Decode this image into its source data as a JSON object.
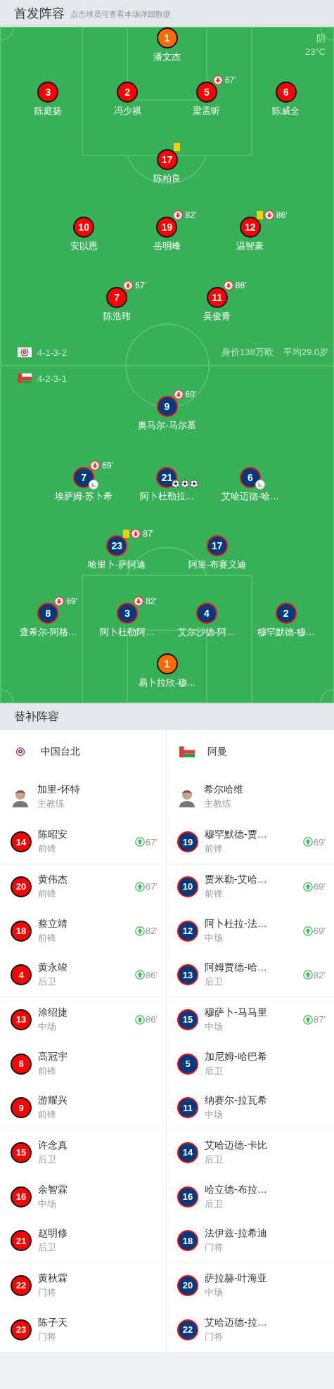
{
  "lineup": {
    "title": "首发阵容",
    "hint": "点击球员可查看本场详细数据",
    "weather": {
      "condition": "阴",
      "temperature": "23°C"
    },
    "value": "身价138万欧",
    "average_age": "平均29.0岁",
    "teams": [
      {
        "formation": "4-1-3-2",
        "color": "#ff0000",
        "lines": [
          {
            "kind": "goalkeeper",
            "players": [
              {
                "number": "1",
                "name": "潘文杰"
              }
            ]
          },
          {
            "kind": "outfield",
            "players": [
              {
                "number": "3",
                "name": "陈庭扬"
              },
              {
                "number": "2",
                "name": "冯少祺"
              },
              {
                "number": "5",
                "name": "梁孟昕",
                "events": [
                  {
                    "kind": "sub_off",
                    "minute": "67'"
                  }
                ]
              },
              {
                "number": "6",
                "name": "陈威全"
              }
            ]
          },
          {
            "kind": "outfield",
            "players": [
              {
                "number": "17",
                "name": "陈柏良",
                "events": [
                  {
                    "kind": "yellow_card"
                  }
                ]
              }
            ]
          },
          {
            "kind": "outfield",
            "players": [
              {
                "number": "10",
                "name": "安以恩"
              },
              {
                "number": "19",
                "name": "岳明峰",
                "events": [
                  {
                    "kind": "sub_off",
                    "minute": "82'"
                  }
                ]
              },
              {
                "number": "12",
                "name": "温智豪",
                "events": [
                  {
                    "kind": "yellow_card"
                  },
                  {
                    "kind": "sub_off",
                    "minute": "86'"
                  }
                ]
              }
            ]
          },
          {
            "kind": "outfield",
            "players": [
              {
                "number": "7",
                "name": "陈浩玮",
                "events": [
                  {
                    "kind": "sub_off",
                    "minute": "67'"
                  }
                ]
              },
              {
                "number": "11",
                "name": "吴俊青",
                "events": [
                  {
                    "kind": "sub_off",
                    "minute": "86'"
                  }
                ]
              }
            ]
          }
        ]
      },
      {
        "formation": "4-2-3-1",
        "color": "#003a7d",
        "lines": [
          {
            "kind": "outfield",
            "players": [
              {
                "number": "9",
                "name": "奥马尔-马尔基",
                "events": [
                  {
                    "kind": "sub_off",
                    "minute": "69'"
                  }
                ]
              }
            ]
          },
          {
            "kind": "outfield",
            "players": [
              {
                "number": "7",
                "name": "埃萨姆-苏卜希",
                "events": [
                  {
                    "kind": "sub_off",
                    "minute": "69'"
                  },
                  {
                    "kind": "assist"
                  }
                ]
              },
              {
                "number": "21",
                "name": "阿卜杜勒拉…",
                "events": [
                  {
                    "kind": "goal"
                  },
                  {
                    "kind": "goal"
                  },
                  {
                    "kind": "goal"
                  }
                ]
              },
              {
                "number": "6",
                "name": "艾哈迈德-哈…",
                "events": [
                  {
                    "kind": "assist"
                  }
                ]
              }
            ]
          },
          {
            "kind": "outfield",
            "players": [
              {
                "number": "23",
                "name": "哈里卜-萨阿迪",
                "events": [
                  {
                    "kind": "yellow_card"
                  },
                  {
                    "kind": "sub_off",
                    "minute": "87'"
                  }
                ]
              },
              {
                "number": "17",
                "name": "阿里-布赛义迪"
              }
            ]
          },
          {
            "kind": "outfield",
            "players": [
              {
                "number": "8",
                "name": "查希尔-阿格…",
                "events": [
                  {
                    "kind": "sub_off",
                    "minute": "69'"
                  }
                ]
              },
              {
                "number": "3",
                "name": "阿卜杜勒阿…",
                "events": [
                  {
                    "kind": "sub_off",
                    "minute": "82'"
                  }
                ]
              },
              {
                "number": "4",
                "name": "艾尔沙德-阿…"
              },
              {
                "number": "2",
                "name": "穆罕默德-穆…"
              }
            ]
          },
          {
            "kind": "goalkeeper",
            "players": [
              {
                "number": "1",
                "name": "易卜拉欣-穆…"
              }
            ]
          }
        ]
      }
    ]
  },
  "substitutes": {
    "title": "替补阵容",
    "teams": [
      {
        "name": "中国台北",
        "color": "#ff0000",
        "coach": {
          "name": "加里-怀特",
          "role": "主教练"
        },
        "players": [
          {
            "number": "14",
            "name": "陈昭安",
            "position": "前锋",
            "sub_on": "67'"
          },
          {
            "number": "20",
            "name": "黄伟杰",
            "position": "前锋",
            "sub_on": "67'"
          },
          {
            "number": "18",
            "name": "蔡立靖",
            "position": "前锋",
            "sub_on": "82'"
          },
          {
            "number": "4",
            "name": "黄永竣",
            "position": "后卫",
            "sub_on": "86'"
          },
          {
            "number": "13",
            "name": "涂绍捷",
            "position": "中场",
            "sub_on": "86'"
          },
          {
            "number": "8",
            "name": "高冠宇",
            "position": "前锋"
          },
          {
            "number": "9",
            "name": "游耀兴",
            "position": "前锋"
          },
          {
            "number": "15",
            "name": "许念真",
            "position": "后卫"
          },
          {
            "number": "16",
            "name": "余智霖",
            "position": "中场"
          },
          {
            "number": "21",
            "name": "赵明修",
            "position": "后卫"
          },
          {
            "number": "22",
            "name": "黄秋霖",
            "position": "门将"
          },
          {
            "number": "23",
            "name": "陈子天",
            "position": "门将"
          }
        ]
      },
      {
        "name": "阿曼",
        "color": "#003a7d",
        "coach": {
          "name": "希尔哈维",
          "role": "主教练"
        },
        "players": [
          {
            "number": "19",
            "name": "穆罕默德-贾…",
            "position": "前锋",
            "sub_on": "69'"
          },
          {
            "number": "10",
            "name": "贾米勒-艾哈…",
            "position": "前锋",
            "sub_on": "69'"
          },
          {
            "number": "12",
            "name": "阿卜杜拉-法…",
            "position": "中场",
            "sub_on": "69'"
          },
          {
            "number": "13",
            "name": "阿姆贾德-哈…",
            "position": "后卫",
            "sub_on": "82'"
          },
          {
            "number": "15",
            "name": "穆萨卜-马马里",
            "position": "中场",
            "sub_on": "87'"
          },
          {
            "number": "5",
            "name": "加尼姆-哈巴希",
            "position": "后卫"
          },
          {
            "number": "11",
            "name": "纳赛尔-拉瓦希",
            "position": "中场"
          },
          {
            "number": "14",
            "name": "艾哈迈德-卡比",
            "position": "后卫"
          },
          {
            "number": "16",
            "name": "哈立德-布拉…",
            "position": "后卫"
          },
          {
            "number": "18",
            "name": "法伊兹-拉希迪",
            "position": "门将"
          },
          {
            "number": "20",
            "name": "萨拉赫-叶海亚",
            "position": "中场"
          },
          {
            "number": "22",
            "name": "艾哈迈德-拉…",
            "position": "门将"
          }
        ]
      }
    ]
  }
}
